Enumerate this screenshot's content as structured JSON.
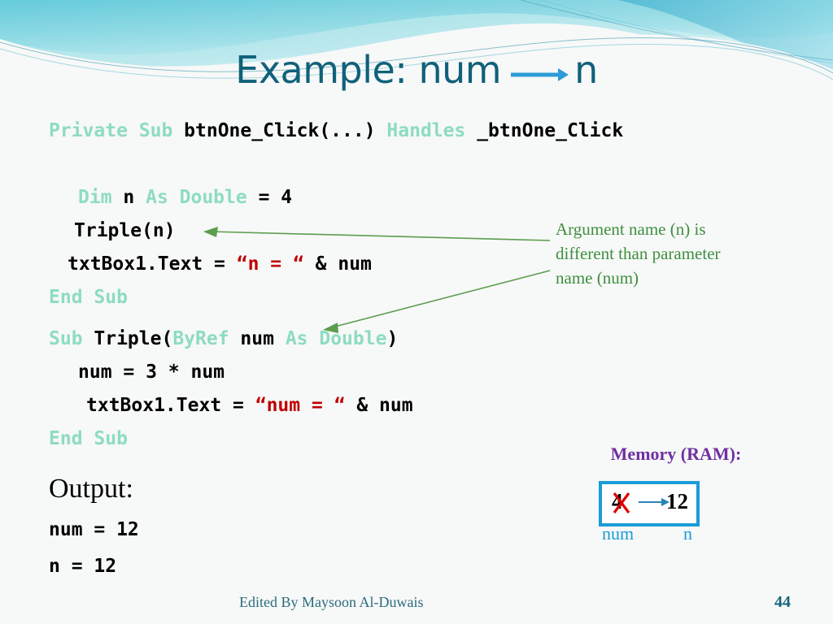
{
  "slide": {
    "title_prefix": "Example: num",
    "title_suffix": "n",
    "title_arrow_icon": "right-arrow-icon",
    "title_color": "#10617a"
  },
  "code": {
    "lines": [
      {
        "id": "code-line-1",
        "tokens": [
          {
            "t": "Private Sub ",
            "c": "kw"
          },
          {
            "t": "btnOne_Click(...) ",
            "c": "id"
          },
          {
            "t": "Handles ",
            "c": "kw"
          },
          {
            "t": "_btnOne_Click",
            "c": "id"
          }
        ]
      },
      {
        "id": "code-line-2",
        "tokens": [
          {
            "t": "Dim ",
            "c": "kw"
          },
          {
            "t": "n ",
            "c": "id"
          },
          {
            "t": "As Double ",
            "c": "kw"
          },
          {
            "t": "= 4",
            "c": "id"
          }
        ]
      },
      {
        "id": "code-line-3",
        "tokens": [
          {
            "t": "Triple(n)",
            "c": "id"
          }
        ]
      },
      {
        "id": "code-line-4",
        "tokens": [
          {
            "t": "txtBox1.Text = ",
            "c": "id"
          },
          {
            "t": "“n = “",
            "c": "str"
          },
          {
            "t": " & num",
            "c": "id"
          }
        ]
      },
      {
        "id": "code-line-5",
        "tokens": [
          {
            "t": "End Sub",
            "c": "kw"
          }
        ]
      },
      {
        "id": "code-line-6",
        "tokens": [
          {
            "t": "Sub ",
            "c": "kw"
          },
          {
            "t": "Triple(",
            "c": "id"
          },
          {
            "t": "ByRef ",
            "c": "kw"
          },
          {
            "t": "num ",
            "c": "id"
          },
          {
            "t": "As Double",
            "c": "kw"
          },
          {
            "t": ")",
            "c": "id"
          }
        ]
      },
      {
        "id": "code-line-7",
        "tokens": [
          {
            "t": "num = 3 * num",
            "c": "id"
          }
        ]
      },
      {
        "id": "code-line-8",
        "tokens": [
          {
            "t": "txtBox1.Text = ",
            "c": "id"
          },
          {
            "t": "“num = “",
            "c": "str"
          },
          {
            "t": " & num",
            "c": "id"
          }
        ]
      },
      {
        "id": "code-line-9",
        "tokens": [
          {
            "t": "End Sub",
            "c": "kw"
          }
        ]
      }
    ],
    "keyword_color": "#8ddcc1",
    "string_color": "#c00000",
    "identifier_color": "#000000"
  },
  "annotation": {
    "line1": "Argument name (n) is",
    "line2": "different than parameter",
    "line3": "name (num)",
    "color": "#3f8f3f",
    "arrow_icon": "callout-arrow-icon"
  },
  "output": {
    "heading": "Output:",
    "lines": [
      "num = 12",
      "n = 12"
    ]
  },
  "memory": {
    "heading": "Memory (RAM):",
    "heading_color": "#7030a0",
    "old_value": "4",
    "new_value": "12",
    "arrow_icon": "right-arrow-icon",
    "strike_icon": "red-x-strike-icon",
    "label_left": "num",
    "label_right": "n",
    "border_color": "#1b9cd8",
    "label_color": "#1b9cd8"
  },
  "footer": {
    "credit": "Edited By Maysoon Al-Duwais",
    "page_number": "44"
  }
}
